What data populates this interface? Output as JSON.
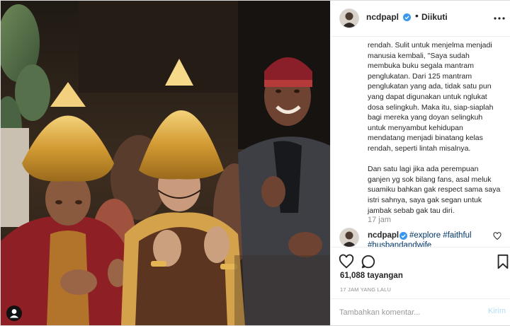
{
  "post": {
    "username": "ncdpapl",
    "follow_status": "Diikuti",
    "separator": "•",
    "caption_paragraphs": [
      "rendah. Sulit untuk menjelma menjadi manusia kembali, \"Saya sudah membuka buku segala mantram penglukatan. Dari 125 mantram penglukatan yang ada, tidak satu pun yang dapat digunakan untuk nglukat dosa selingkuh. Maka itu, siap-siaplah bagi mereka yang doyan selingkuh untuk menyambut kehidupan mendatang menjadi binatang kelas rendah, seperti lintah misalnya.",
      "Dan satu lagi jika ada perempuan ganjen yg sok bilang fans, asal meluk suamiku bahkan gak respect sama saya istri sahnya, saya gak segan untuk jambak sebab gak tau diri."
    ],
    "caption_time": "17 jam",
    "comment": {
      "username": "ncdpapl",
      "hashtags_line1": "#explore #faithful",
      "hashtags_line2": "#husbandandwife"
    },
    "views": "61,088 tayangan",
    "posted_ago": "17 JAM YANG LALU",
    "comment_placeholder": "Tambahkan komentar...",
    "post_button": "Kirim"
  },
  "icons": {
    "verified": "verified-badge-icon",
    "more": "more-options-icon",
    "heart": "heart-icon",
    "comment": "comment-icon",
    "bookmark": "bookmark-icon",
    "tagged_user": "tagged-user-icon"
  },
  "colors": {
    "verified_blue": "#3897f0",
    "hashtag_blue": "#003569",
    "muted_gray": "#8e8e8e",
    "post_button_disabled": "#b2dffc"
  }
}
